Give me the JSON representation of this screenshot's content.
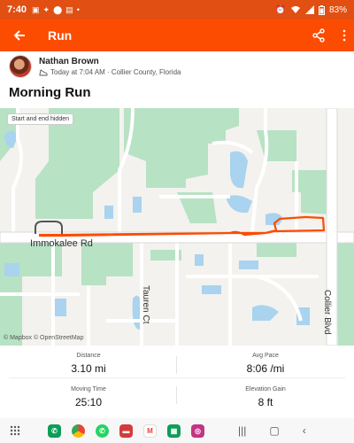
{
  "status_bar": {
    "time": "7:40",
    "battery": "83%"
  },
  "app_bar": {
    "title": "Run"
  },
  "athlete": {
    "name": "Nathan Brown",
    "meta": "Today at 7:04 AM · Collier County, Florida"
  },
  "activity": {
    "title": "Morning Run"
  },
  "map": {
    "badge": "Start and end hidden",
    "attribution": "© Mapbox © OpenStreetMap",
    "road_labels": {
      "immokalee": "Immokalee Rd",
      "tauren": "Tauren Ct",
      "collier": "Collier Blvd"
    },
    "colors": {
      "route": "#fc4c02",
      "hidden_route": "#555555",
      "park": "#b7e2c4",
      "water": "#a9d3ee"
    }
  },
  "stats": {
    "distance": {
      "label": "Distance",
      "value": "3.10 mi"
    },
    "avg_pace": {
      "label": "Avg Pace",
      "value": "8:06 /mi"
    },
    "moving_time": {
      "label": "Moving Time",
      "value": "25:10"
    },
    "elevation_gain": {
      "label": "Elevation Gain",
      "value": "8 ft"
    }
  },
  "colors": {
    "brand": "#fc4c02",
    "status_bar": "#e14f12"
  },
  "dock_icons": [
    "phone-icon",
    "chrome-icon",
    "whatsapp-icon",
    "messages-icon",
    "gmail-icon",
    "sheets-icon",
    "instagram-icon"
  ]
}
